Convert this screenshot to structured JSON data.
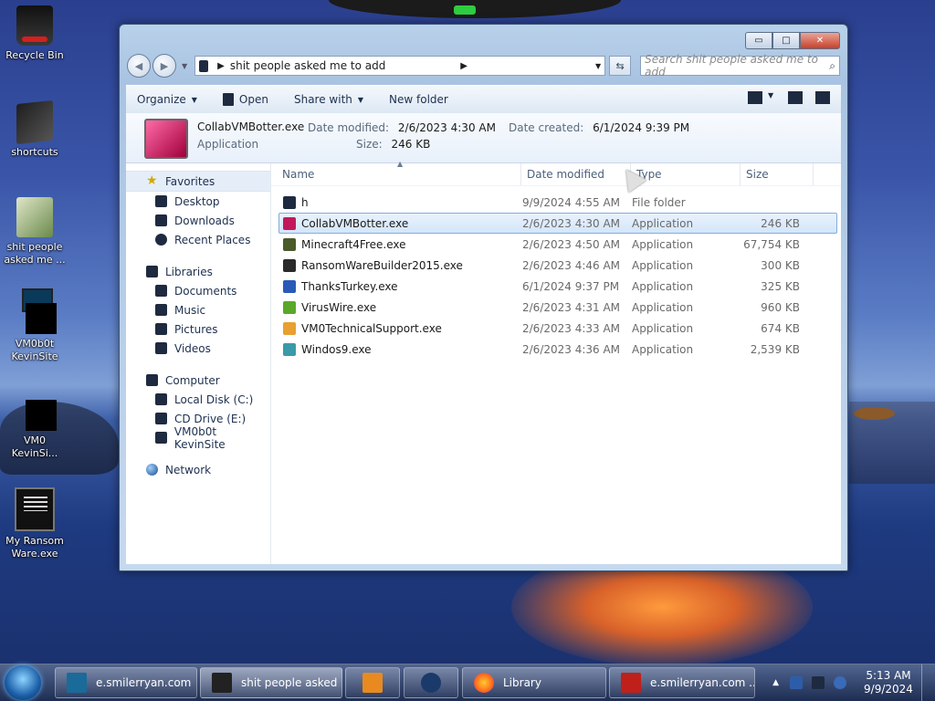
{
  "desktop": {
    "icons": [
      {
        "label": "Recycle Bin"
      },
      {
        "label": "shortcuts"
      },
      {
        "label": "shit people asked me ..."
      },
      {
        "label": "VM0b0t KevinSite"
      },
      {
        "label": "VM0 KevinSi..."
      },
      {
        "label": "My Ransom Ware.exe"
      }
    ]
  },
  "window": {
    "address_path": "shit people asked me to add",
    "search_placeholder": "Search shit people asked me to add",
    "controls": {
      "minimize": "▭",
      "maximize": "□",
      "close": "✕"
    },
    "toolbar": {
      "organize": "Organize",
      "open": "Open",
      "share_with": "Share with",
      "new_folder": "New folder"
    },
    "details": {
      "name": "CollabVMBotter.exe",
      "type": "Application",
      "date_modified_label": "Date modified:",
      "date_modified": "2/6/2023 4:30 AM",
      "date_created_label": "Date created:",
      "date_created": "6/1/2024 9:39 PM",
      "size_label": "Size:",
      "size": "246 KB"
    },
    "nav": {
      "favorites": "Favorites",
      "favorites_items": [
        "Desktop",
        "Downloads",
        "Recent Places"
      ],
      "libraries": "Libraries",
      "libraries_items": [
        "Documents",
        "Music",
        "Pictures",
        "Videos"
      ],
      "computer": "Computer",
      "computer_items": [
        "Local Disk (C:)",
        "CD Drive (E:)",
        "VM0b0t KevinSite"
      ],
      "network": "Network"
    },
    "columns": {
      "name": "Name",
      "date": "Date modified",
      "type": "Type",
      "size": "Size"
    },
    "files": [
      {
        "name": "h",
        "date": "9/9/2024 4:55 AM",
        "type": "File folder",
        "size": "",
        "color": "#1e2a40"
      },
      {
        "name": "CollabVMBotter.exe",
        "date": "2/6/2023 4:30 AM",
        "type": "Application",
        "size": "246 KB",
        "color": "#c2185b",
        "selected": true
      },
      {
        "name": "Minecraft4Free.exe",
        "date": "2/6/2023 4:50 AM",
        "type": "Application",
        "size": "67,754 KB",
        "color": "#4a5a2a"
      },
      {
        "name": "RansomWareBuilder2015.exe",
        "date": "2/6/2023 4:46 AM",
        "type": "Application",
        "size": "300 KB",
        "color": "#2a2a2a"
      },
      {
        "name": "ThanksTurkey.exe",
        "date": "6/1/2024 9:37 PM",
        "type": "Application",
        "size": "325 KB",
        "color": "#2a5ab8"
      },
      {
        "name": "VirusWire.exe",
        "date": "2/6/2023 4:31 AM",
        "type": "Application",
        "size": "960 KB",
        "color": "#5aa82a"
      },
      {
        "name": "VM0TechnicalSupport.exe",
        "date": "2/6/2023 4:33 AM",
        "type": "Application",
        "size": "674 KB",
        "color": "#e8a030"
      },
      {
        "name": "Windos9.exe",
        "date": "2/6/2023 4:36 AM",
        "type": "Application",
        "size": "2,539 KB",
        "color": "#3a9aa8"
      }
    ]
  },
  "taskbar": {
    "buttons": [
      {
        "label": "e.smilerryan.com",
        "color": "#1a6a9a"
      },
      {
        "label": "shit people asked ...",
        "color": "#222"
      },
      {
        "label": "",
        "color": "#e88a20"
      },
      {
        "label": "",
        "color": "#1a3a6a"
      },
      {
        "label": "Library",
        "color": "#ff6a1a"
      },
      {
        "label": "e.smilerryan.com ...",
        "color": "#c0201a"
      }
    ],
    "time": "5:13 AM",
    "date": "9/9/2024"
  }
}
